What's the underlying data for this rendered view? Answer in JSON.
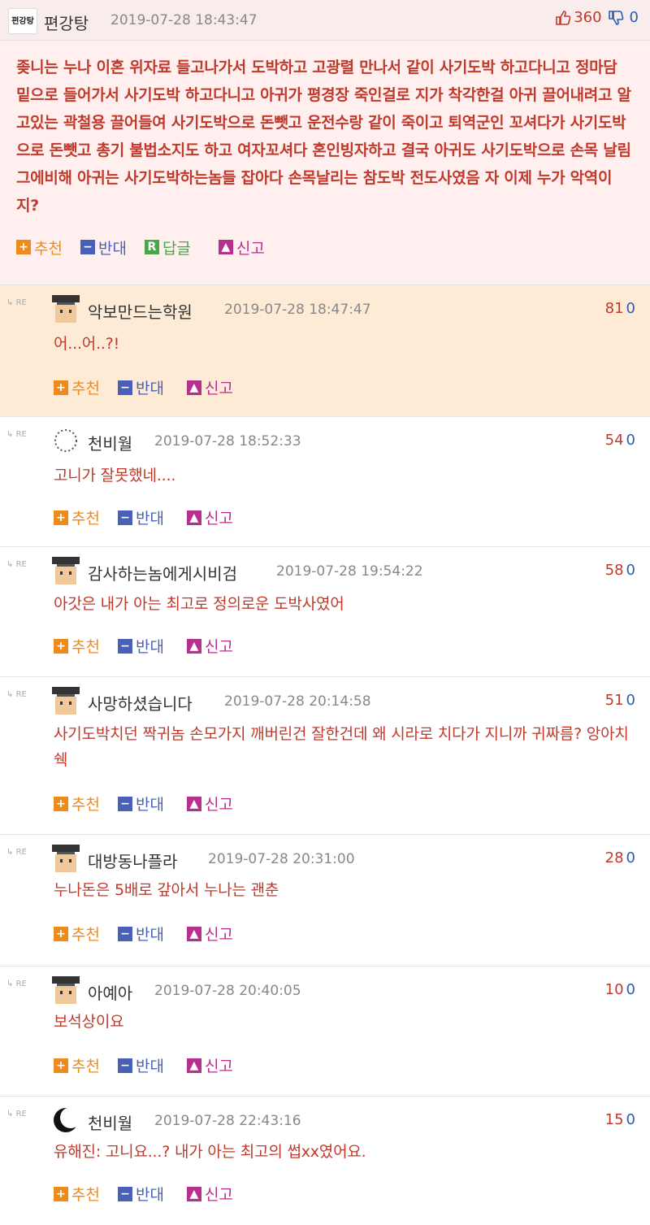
{
  "post": {
    "avatar_text": "편강탕",
    "author": "편강탕",
    "date": "2019-07-28 18:43:47",
    "likes": "360",
    "dislikes": "0",
    "body": "좆니는 누나 이혼 위자료 들고나가서 도박하고 고광렬 만나서 같이 사기도박 하고다니고 정마담 밑으로 들어가서 사기도박 하고다니고 아귀가 평경장 죽인걸로 지가 착각한걸 아귀 끌어내려고 알고있는 곽철용 끌어들여 사기도박으로 돈뺏고 운전수랑 같이 죽이고 퇴역군인 꼬셔다가 사기도박으로 돈뺏고 총기 불법소지도 하고 여자꼬셔다 혼인빙자하고 결국 아귀도 사기도박으로 손목 날림 그에비해 아귀는 사기도박하는놈들 잡아다 손목날리는 참도박 전도사였음 자 이제 누가 악역이지?",
    "actions": {
      "recommend": "추천",
      "oppose": "반대",
      "reply": "답글",
      "report": "신고"
    }
  },
  "icons": {
    "like": "thumbs-up-icon",
    "dislike": "thumbs-down-icon",
    "re": "reply-arrow-icon"
  },
  "labels": {
    "re": "RE"
  },
  "comment_actions": {
    "recommend": "추천",
    "oppose": "반대",
    "report": "신고"
  },
  "comments": [
    {
      "author": "악보만드는학원",
      "date": "2019-07-28 18:47:47",
      "up": "81",
      "down": "0",
      "body": "어...어..?!"
    },
    {
      "author": "천비월",
      "date": "2019-07-28 18:52:33",
      "up": "54",
      "down": "0",
      "body": "고니가 잘못했네...."
    },
    {
      "author": "감사하는놈에게시비검",
      "date": "2019-07-28 19:54:22",
      "up": "58",
      "down": "0",
      "body": "아갓은 내가 아는 최고로 정의로운 도박사였어"
    },
    {
      "author": "사망하셨습니다",
      "date": "2019-07-28 20:14:58",
      "up": "51",
      "down": "0",
      "body": "사기도박치던 짝귀놈 손모가지 깨버린건 잘한건데 왜 시라로 치다가 지니까 귀짜름? 앙아치쉑"
    },
    {
      "author": "대방동나플라",
      "date": "2019-07-28 20:31:00",
      "up": "28",
      "down": "0",
      "body": "누나돈은 5배로 갚아서 누나는 괜춘"
    },
    {
      "author": "아예아",
      "date": "2019-07-28 20:40:05",
      "up": "10",
      "down": "0",
      "body": "보석상이요"
    },
    {
      "author": "천비월",
      "date": "2019-07-28 22:43:16",
      "up": "15",
      "down": "0",
      "body": "유해진: 고니요...? 내가 아는 최고의 썹xx였어요."
    }
  ]
}
